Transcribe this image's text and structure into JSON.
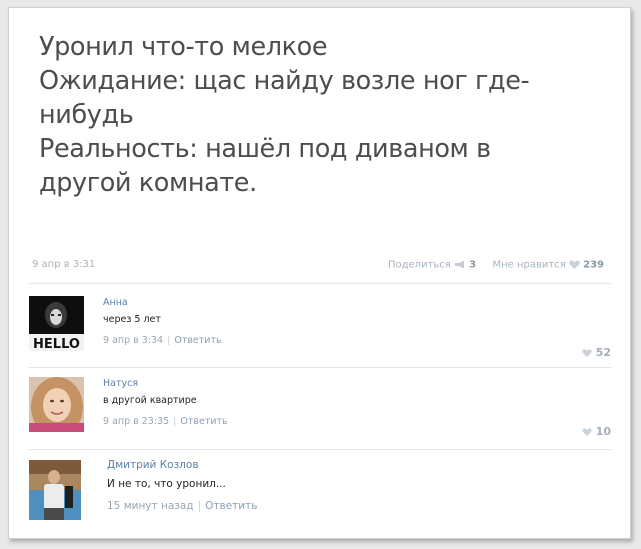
{
  "post": {
    "lines": [
      "Уронил что-то мелкое",
      "Ожидание: щас найду возле ног где-",
      "нибудь",
      "Реальность: нашёл под диваном в",
      "другой комнате."
    ],
    "date": "9 апр в 3:31",
    "share_label": "Поделиться",
    "share_count": "3",
    "like_label": "Мне нравится",
    "like_count": "239"
  },
  "comments": [
    {
      "author": "Анна",
      "text": "через 5 лет",
      "time": "9 апр в 3:34",
      "reply_label": "Ответить",
      "likes": "52",
      "avatar_text": "HELLO",
      "like_icon": "heart-icon"
    },
    {
      "author": "Натуся",
      "text": "в другой квартире",
      "time": "9 апр в 23:35",
      "reply_label": "Ответить",
      "likes": "10",
      "like_icon": "heart-icon"
    },
    {
      "author": "Дмитрий Козлов",
      "text": "И не то, что уронил...",
      "time": "15 минут назад",
      "reply_label": "Ответить"
    }
  ],
  "colors": {
    "link": "#5b7fa6",
    "meta": "#a9b2bd",
    "post_text": "#4d4d4d"
  }
}
